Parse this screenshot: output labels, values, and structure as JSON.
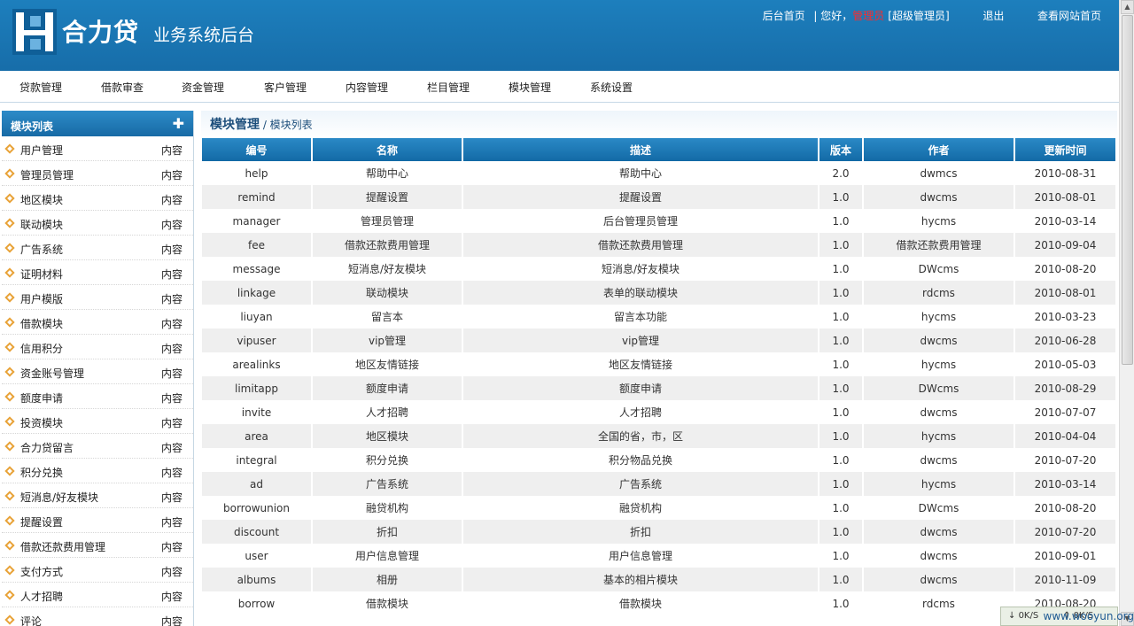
{
  "brand": {
    "title": "合力贷",
    "subtitle": "业务系统后台"
  },
  "toplinks": {
    "home": "后台首页",
    "greeting": "| 您好，",
    "username": "管理员",
    "role": "[超级管理员]",
    "logout": "退出",
    "site_home": "查看网站首页"
  },
  "nav": [
    "贷款管理",
    "借款审查",
    "资金管理",
    "客户管理",
    "内容管理",
    "栏目管理",
    "模块管理",
    "系统设置"
  ],
  "sidebar": {
    "title": "模块列表",
    "items": [
      {
        "label": "用户管理",
        "action": "内容"
      },
      {
        "label": "管理员管理",
        "action": "内容"
      },
      {
        "label": "地区模块",
        "action": "内容"
      },
      {
        "label": "联动模块",
        "action": "内容"
      },
      {
        "label": "广告系统",
        "action": "内容"
      },
      {
        "label": "证明材料",
        "action": "内容"
      },
      {
        "label": "用户模版",
        "action": "内容"
      },
      {
        "label": "借款模块",
        "action": "内容"
      },
      {
        "label": "信用积分",
        "action": "内容"
      },
      {
        "label": "资金账号管理",
        "action": "内容"
      },
      {
        "label": "额度申请",
        "action": "内容"
      },
      {
        "label": "投资模块",
        "action": "内容"
      },
      {
        "label": "合力贷留言",
        "action": "内容"
      },
      {
        "label": "积分兑换",
        "action": "内容"
      },
      {
        "label": "短消息/好友模块",
        "action": "内容"
      },
      {
        "label": "提醒设置",
        "action": "内容"
      },
      {
        "label": "借款还款费用管理",
        "action": "内容"
      },
      {
        "label": "支付方式",
        "action": "内容"
      },
      {
        "label": "人才招聘",
        "action": "内容"
      },
      {
        "label": "评论",
        "action": "内容"
      }
    ]
  },
  "breadcrumb": {
    "section": "模块管理",
    "page": "/ 模块列表"
  },
  "table": {
    "headers": [
      "编号",
      "名称",
      "描述",
      "版本",
      "作者",
      "更新时间"
    ],
    "rows": [
      [
        "help",
        "帮助中心",
        "帮助中心",
        "2.0",
        "dwmcs",
        "2010-08-31"
      ],
      [
        "remind",
        "提醒设置",
        "提醒设置",
        "1.0",
        "dwcms",
        "2010-08-01"
      ],
      [
        "manager",
        "管理员管理",
        "后台管理员管理",
        "1.0",
        "hycms",
        "2010-03-14"
      ],
      [
        "fee",
        "借款还款费用管理",
        "借款还款费用管理",
        "1.0",
        "借款还款费用管理",
        "2010-09-04"
      ],
      [
        "message",
        "短消息/好友模块",
        "短消息/好友模块",
        "1.0",
        "DWcms",
        "2010-08-20"
      ],
      [
        "linkage",
        "联动模块",
        "表单的联动模块",
        "1.0",
        "rdcms",
        "2010-08-01"
      ],
      [
        "liuyan",
        "留言本",
        "留言本功能",
        "1.0",
        "hycms",
        "2010-03-23"
      ],
      [
        "vipuser",
        "vip管理",
        "vip管理",
        "1.0",
        "dwcms",
        "2010-06-28"
      ],
      [
        "arealinks",
        "地区友情链接",
        "地区友情链接",
        "1.0",
        "hycms",
        "2010-05-03"
      ],
      [
        "limitapp",
        "额度申请",
        "额度申请",
        "1.0",
        "DWcms",
        "2010-08-29"
      ],
      [
        "invite",
        "人才招聘",
        "人才招聘",
        "1.0",
        "dwcms",
        "2010-07-07"
      ],
      [
        "area",
        "地区模块",
        "全国的省，市，区",
        "1.0",
        "hycms",
        "2010-04-04"
      ],
      [
        "integral",
        "积分兑换",
        "积分物品兑换",
        "1.0",
        "dwcms",
        "2010-07-20"
      ],
      [
        "ad",
        "广告系统",
        "广告系统",
        "1.0",
        "hycms",
        "2010-03-14"
      ],
      [
        "borrowunion",
        "融贷机构",
        "融贷机构",
        "1.0",
        "DWcms",
        "2010-08-20"
      ],
      [
        "discount",
        "折扣",
        "折扣",
        "1.0",
        "dwcms",
        "2010-07-20"
      ],
      [
        "user",
        "用户信息管理",
        "用户信息管理",
        "1.0",
        "dwcms",
        "2010-09-01"
      ],
      [
        "albums",
        "相册",
        "基本的相片模块",
        "1.0",
        "dwcms",
        "2010-11-09"
      ],
      [
        "borrow",
        "借款模块",
        "借款模块",
        "1.0",
        "rdcms",
        "2010-08-20"
      ]
    ]
  },
  "status": {
    "down": "0K/S",
    "up": "0K/S"
  },
  "watermark": "www.wooyun.org"
}
